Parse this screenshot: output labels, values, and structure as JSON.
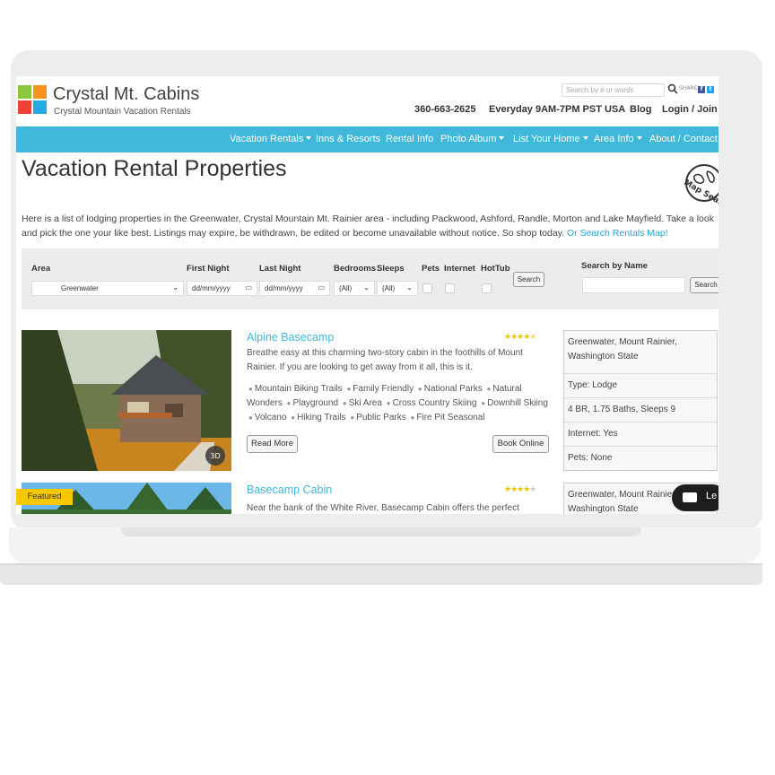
{
  "header": {
    "site_title": "Crystal Mt. Cabins",
    "site_subtitle": "Crystal Mountain Vacation Rentals",
    "search_placeholder": "Search by # or words",
    "share_label": "SHARE",
    "phone": "360-663-2625",
    "hours": "Everyday 9AM-7PM PST USA",
    "blog": "Blog",
    "login": "Login / Join"
  },
  "nav": {
    "items": [
      "Vacation Rentals",
      "Inns & Resorts",
      "Rental Info",
      "Photo Album",
      "List Your Home",
      "Area Info",
      "About / Contact"
    ]
  },
  "page": {
    "title": "Vacation Rental Properties",
    "map_badge": "Map Search",
    "intro": "Here is a list of lodging properties in the Greenwater, Crystal Mountain Mt. Rainier area - including Packwood, Ashford, Randle, Morton and Lake Mayfield. Take a look and pick the one your like best. Listings may expire, be withdrawn, be edited or become unavailable without notice. So shop today.",
    "intro_link": "Or Search Rentals Map!"
  },
  "search": {
    "area_label": "Area",
    "area_value": "Greenwater",
    "first_night_label": "First Night",
    "first_night_value": "dd/mm/yyyy",
    "last_night_label": "Last Night",
    "last_night_value": "dd/mm/yyyy",
    "bedrooms_label": "Bedrooms",
    "bedrooms_value": "(All)",
    "sleeps_label": "Sleeps",
    "sleeps_value": "(All)",
    "pets_label": "Pets",
    "internet_label": "Internet",
    "hottub_label": "HotTub",
    "search_button": "Search",
    "by_name_label": "Search by Name",
    "by_name_button": "Search"
  },
  "listings": [
    {
      "title": "Alpine Basecamp",
      "rating": 4.5,
      "description": "Breathe easy at this charming two-story cabin in the foothills of Mount Rainier. If you are looking to get away from it all, this is it.",
      "features": [
        "Mountain Biking Trails",
        "Family Friendly",
        "National Parks",
        "Natural Wonders",
        "Playground",
        "Ski Area",
        "Cross Country Skiing",
        "Downhill Skiing",
        "Volcano",
        "Hiking Trails",
        "Public Parks",
        "Fire Pit Seasonal"
      ],
      "read_more": "Read More",
      "book_online": "Book Online",
      "location": "Greenwater, Mount Rainier, Washington State",
      "type": "Type: Lodge",
      "rooms": "4 BR, 1.75 Baths, Sleeps 9",
      "internet": "Internet: Yes",
      "pets": "Pets: None",
      "tour_badge": "3D"
    },
    {
      "title": "Basecamp Cabin",
      "rating": 4,
      "badge": "Featured",
      "description": "Near the bank of the White River, Basecamp Cabin offers the perfect",
      "location": "Greenwater, Mount Rainier, Washington State"
    }
  ],
  "chat": {
    "label": "Le"
  },
  "colors": {
    "accent": "#3fb8d9",
    "star": "#f2c200",
    "featured": "#f7c800"
  }
}
